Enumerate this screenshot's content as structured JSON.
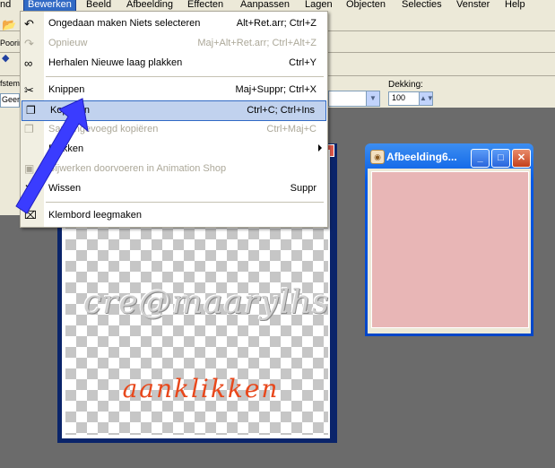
{
  "menubar": {
    "items": [
      "nd",
      "Bewerken",
      "Beeld",
      "Afbeelding",
      "Effecten",
      "Aanpassen",
      "Lagen",
      "Objecten",
      "Selecties",
      "Venster",
      "Help"
    ]
  },
  "toolbar": {
    "label_poorin": "Poorins",
    "label_afstem": "fstem",
    "combo_geen": "Geen",
    "dekking_label": "Dekking:",
    "dekking_value": "100"
  },
  "edit_menu": {
    "items": [
      {
        "label": "Ongedaan maken Niets selecteren",
        "shortcut": "Alt+Ret.arr; Ctrl+Z",
        "enabled": true
      },
      {
        "label": "Opnieuw",
        "shortcut": "Maj+Alt+Ret.arr; Ctrl+Alt+Z",
        "enabled": false
      },
      {
        "label": "Herhalen  Nieuwe laag plakken",
        "shortcut": "Ctrl+Y",
        "enabled": true
      },
      {
        "label": "Knippen",
        "shortcut": "Maj+Suppr; Ctrl+X",
        "enabled": true
      },
      {
        "label": "Kopiëren",
        "shortcut": "Ctrl+C; Ctrl+Ins",
        "enabled": true,
        "highlighted": true
      },
      {
        "label": "Samengevoegd kopiëren",
        "shortcut": "Ctrl+Maj+C",
        "enabled": false
      },
      {
        "label": "Plakken",
        "shortcut": "",
        "enabled": true,
        "submenu": true
      },
      {
        "label": "Bijwerken doorvoeren in Animation Shop",
        "shortcut": "",
        "enabled": false
      },
      {
        "label": "Wissen",
        "shortcut": "Suppr",
        "enabled": true
      },
      {
        "label": "Klembord leegmaken",
        "shortcut": "",
        "enabled": true
      }
    ]
  },
  "document": {
    "watermark": "cre@maarylhs",
    "overlay_text": "aanklikken"
  },
  "afbeelding_window": {
    "title": "Afbeelding6...",
    "canvas_color": "#e8b6b6"
  },
  "colors": {
    "highlight_bg": "#c1d2ee",
    "highlight_border": "#316ac5",
    "arrow": "#3a3cff",
    "overlay_text": "#e8481c"
  }
}
